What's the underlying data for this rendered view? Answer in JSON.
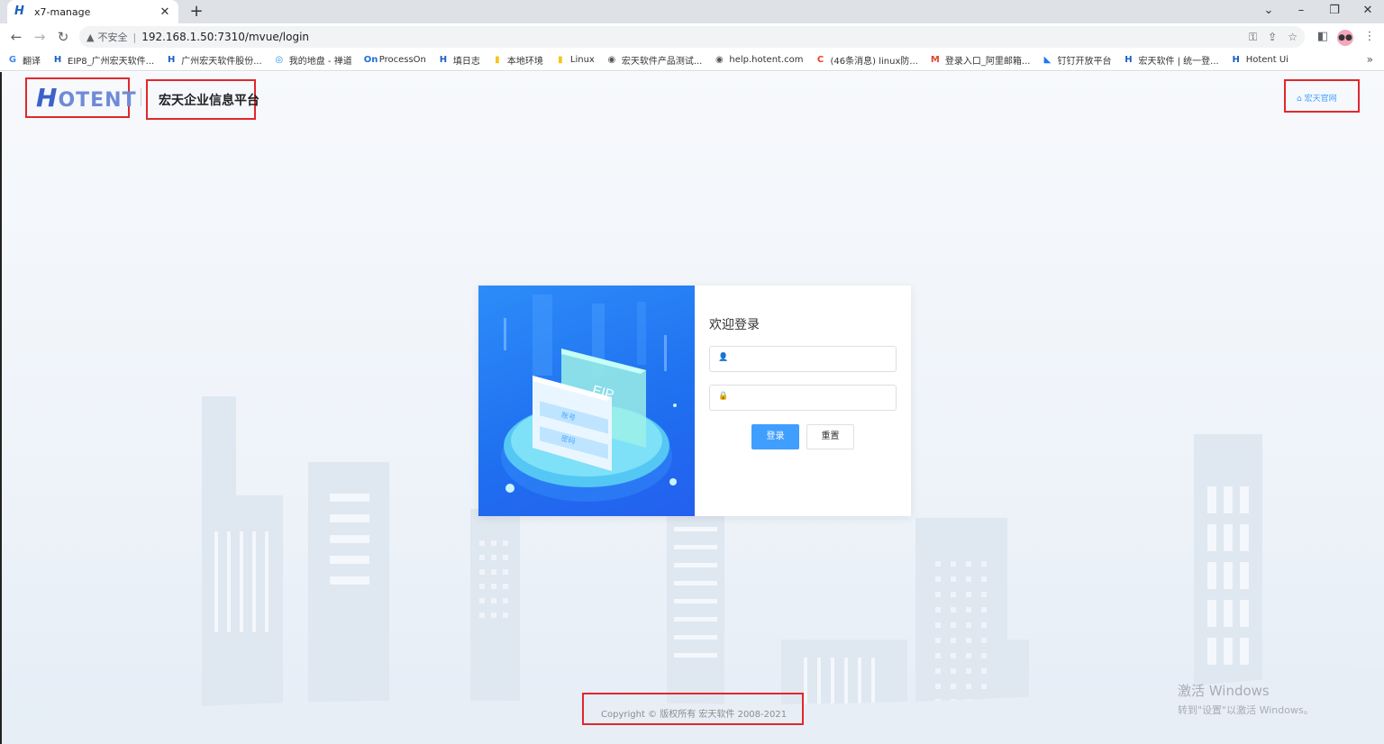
{
  "browser": {
    "tab_title": "x7-manage",
    "tab_favicon": "H",
    "url": "192.168.1.50:7310/mvue/login",
    "security_label": "不安全",
    "bookmarks": [
      {
        "label": "翻译",
        "icon": "translate-icon",
        "color": "#4285f4",
        "glyph": "G"
      },
      {
        "label": "EIP8_广州宏天软件...",
        "icon": "hotent-icon",
        "color": "#1a5fc2",
        "glyph": "H"
      },
      {
        "label": "广州宏天软件股份...",
        "icon": "hotent-icon",
        "color": "#1a5fc2",
        "glyph": "H"
      },
      {
        "label": "我的地盘 - 禅道",
        "icon": "zentao-icon",
        "color": "#2196f3",
        "glyph": "◎"
      },
      {
        "label": "ProcessOn",
        "icon": "processon-icon",
        "color": "#1e6fd9",
        "glyph": "On"
      },
      {
        "label": "填日志",
        "icon": "hotent-icon",
        "color": "#1a5fc2",
        "glyph": "H"
      },
      {
        "label": "本地环境",
        "icon": "folder-icon",
        "color": "#f5c518",
        "glyph": "▮"
      },
      {
        "label": "Linux",
        "icon": "folder-icon",
        "color": "#f5c518",
        "glyph": "▮"
      },
      {
        "label": "宏天软件产品测试...",
        "icon": "globe-icon",
        "color": "#555555",
        "glyph": "◉"
      },
      {
        "label": "help.hotent.com",
        "icon": "globe-icon",
        "color": "#555555",
        "glyph": "◉"
      },
      {
        "label": "(46条消息) linux防...",
        "icon": "csdn-icon",
        "color": "#e8412c",
        "glyph": "C"
      },
      {
        "label": "登录入口_阿里邮箱...",
        "icon": "mail-icon",
        "color": "#e8412c",
        "glyph": "M"
      },
      {
        "label": "钉钉开放平台",
        "icon": "dingtalk-icon",
        "color": "#1677ff",
        "glyph": "◣"
      },
      {
        "label": "宏天软件 | 统一登...",
        "icon": "hotent-icon",
        "color": "#1a5fc2",
        "glyph": "H"
      },
      {
        "label": "Hotent Ui",
        "icon": "hotent-icon",
        "color": "#1a5fc2",
        "glyph": "H"
      }
    ]
  },
  "header": {
    "logo_text": "OTENT",
    "logo_initial": "H",
    "platform_title": "宏天企业信息平台",
    "home_link": "宏天官网"
  },
  "login": {
    "welcome": "欢迎登录",
    "username_value": "",
    "password_value": "",
    "login_button": "登录",
    "reset_button": "重置",
    "art_text_eip": "EIP",
    "art_text_account": "账号",
    "art_text_password": "密码"
  },
  "footer": {
    "copyright": "Copyright © 版权所有 宏天软件 2008-2021"
  },
  "watermark": {
    "line1": "激活 Windows",
    "line2": "转到\"设置\"以激活 Windows。"
  },
  "colors": {
    "highlight": "#e0282c",
    "primary": "#409eff",
    "art_blue": "#2d8cf8"
  }
}
